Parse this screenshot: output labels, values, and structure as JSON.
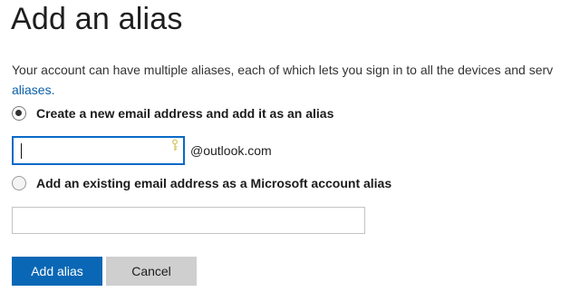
{
  "page": {
    "title": "Add an alias",
    "description_line1": "Your account can have multiple aliases, each of which lets you sign in to all the devices and serv",
    "description_link": "aliases."
  },
  "options": {
    "create_new": {
      "label": "Create a new email address and add it as an alias",
      "selected": true
    },
    "add_existing": {
      "label": "Add an existing email address as a Microsoft account alias",
      "selected": false
    }
  },
  "new_alias": {
    "value": "",
    "domain_suffix": "@outlook.com",
    "icon": "key-icon"
  },
  "existing_alias": {
    "value": ""
  },
  "buttons": {
    "add_alias": "Add alias",
    "cancel": "Cancel"
  },
  "colors": {
    "accent": "#0a67b5",
    "link": "#0a5fa8",
    "focus_border": "#0a6ac6",
    "secondary_button": "#cfcfcf"
  }
}
